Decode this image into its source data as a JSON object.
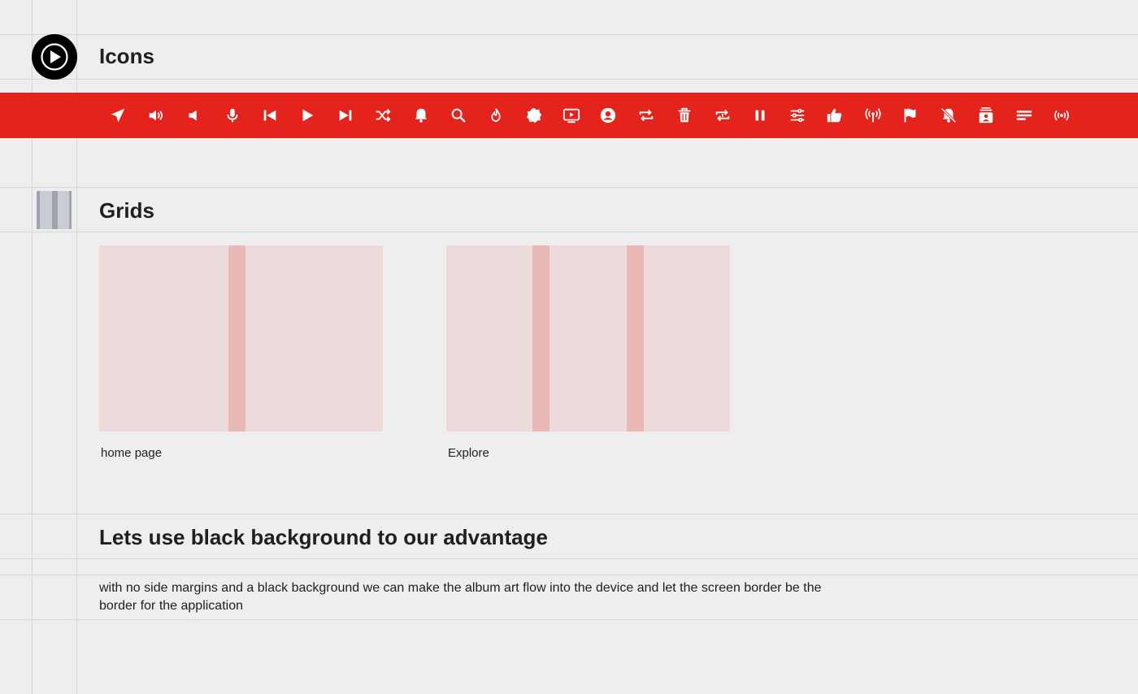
{
  "sections": {
    "icons_title": "Icons",
    "grids_title": "Grids",
    "black_bg_title": "Lets use black background to our advantage",
    "black_bg_text": "with no side margins and a black background we can make the album art flow into the device and let the screen border be the border for the application"
  },
  "grids": [
    {
      "caption": "home page",
      "columns": 2
    },
    {
      "caption": "Explore",
      "columns": 3
    }
  ],
  "icon_bar": {
    "background": "#e4231c",
    "icons": [
      "send-icon",
      "volume-up-icon",
      "volume-down-icon",
      "microphone-icon",
      "skip-previous-icon",
      "play-icon",
      "skip-next-icon",
      "shuffle-icon",
      "bell-icon",
      "search-icon",
      "fire-icon",
      "badge-icon",
      "video-library-icon",
      "account-circle-icon",
      "repeat-icon",
      "trash-icon",
      "repeat-one-icon",
      "pause-icon",
      "sliders-icon",
      "thumbs-up-icon",
      "podcast-icon",
      "flag-icon",
      "bell-off-icon",
      "subscriptions-icon",
      "lines-icon",
      "broadcast-icon"
    ]
  },
  "colors": {
    "page_background": "#eeeeee",
    "accent_red": "#e4231c",
    "grid_background": "#eddada",
    "grid_column": "#ebb8b8",
    "text": "#1f1f1f"
  }
}
